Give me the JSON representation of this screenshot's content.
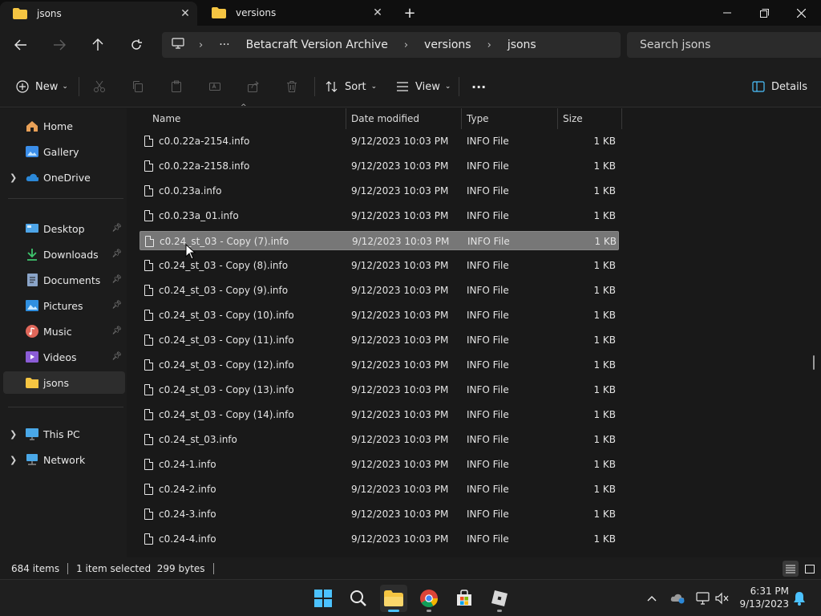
{
  "tabs": [
    {
      "label": "jsons",
      "active": true
    },
    {
      "label": "versions",
      "active": false
    }
  ],
  "new_tab_label": "+",
  "address": {
    "ellipsis": "···",
    "breadcrumbs": [
      "Betacraft Version Archive",
      "versions",
      "jsons"
    ]
  },
  "search": {
    "placeholder": "Search jsons"
  },
  "toolbar": {
    "new_label": "New",
    "sort_label": "Sort",
    "view_label": "View",
    "more_label": "···",
    "details_label": "Details"
  },
  "sidebar": {
    "quick": [
      {
        "label": "Home",
        "icon": "home-icon",
        "expandable": false
      },
      {
        "label": "Gallery",
        "icon": "gallery-icon",
        "expandable": false
      },
      {
        "label": "OneDrive",
        "icon": "cloud-icon",
        "expandable": true
      }
    ],
    "pinned": [
      {
        "label": "Desktop",
        "icon": "desktop-icon",
        "pinned": true
      },
      {
        "label": "Downloads",
        "icon": "download-icon",
        "pinned": true
      },
      {
        "label": "Documents",
        "icon": "document-icon",
        "pinned": true
      },
      {
        "label": "Pictures",
        "icon": "pictures-icon",
        "pinned": true
      },
      {
        "label": "Music",
        "icon": "music-icon",
        "pinned": true
      },
      {
        "label": "Videos",
        "icon": "videos-icon",
        "pinned": true
      },
      {
        "label": "jsons",
        "icon": "folder-icon",
        "pinned": false,
        "selected": true
      }
    ],
    "devices": [
      {
        "label": "This PC",
        "icon": "pc-icon",
        "expandable": true
      },
      {
        "label": "Network",
        "icon": "network-icon",
        "expandable": true
      }
    ]
  },
  "columns": {
    "name": "Name",
    "date": "Date modified",
    "type": "Type",
    "size": "Size"
  },
  "files": [
    {
      "name": "c0.0.22a-2154.info",
      "date": "9/12/2023 10:03 PM",
      "type": "INFO File",
      "size": "1 KB"
    },
    {
      "name": "c0.0.22a-2158.info",
      "date": "9/12/2023 10:03 PM",
      "type": "INFO File",
      "size": "1 KB"
    },
    {
      "name": "c0.0.23a.info",
      "date": "9/12/2023 10:03 PM",
      "type": "INFO File",
      "size": "1 KB"
    },
    {
      "name": "c0.0.23a_01.info",
      "date": "9/12/2023 10:03 PM",
      "type": "INFO File",
      "size": "1 KB"
    },
    {
      "name": "c0.24_st_03 - Copy (7).info",
      "date": "9/12/2023 10:03 PM",
      "type": "INFO File",
      "size": "1 KB",
      "selected": true
    },
    {
      "name": "c0.24_st_03 - Copy (8).info",
      "date": "9/12/2023 10:03 PM",
      "type": "INFO File",
      "size": "1 KB"
    },
    {
      "name": "c0.24_st_03 - Copy (9).info",
      "date": "9/12/2023 10:03 PM",
      "type": "INFO File",
      "size": "1 KB"
    },
    {
      "name": "c0.24_st_03 - Copy (10).info",
      "date": "9/12/2023 10:03 PM",
      "type": "INFO File",
      "size": "1 KB"
    },
    {
      "name": "c0.24_st_03 - Copy (11).info",
      "date": "9/12/2023 10:03 PM",
      "type": "INFO File",
      "size": "1 KB"
    },
    {
      "name": "c0.24_st_03 - Copy (12).info",
      "date": "9/12/2023 10:03 PM",
      "type": "INFO File",
      "size": "1 KB"
    },
    {
      "name": "c0.24_st_03 - Copy (13).info",
      "date": "9/12/2023 10:03 PM",
      "type": "INFO File",
      "size": "1 KB"
    },
    {
      "name": "c0.24_st_03 - Copy (14).info",
      "date": "9/12/2023 10:03 PM",
      "type": "INFO File",
      "size": "1 KB"
    },
    {
      "name": "c0.24_st_03.info",
      "date": "9/12/2023 10:03 PM",
      "type": "INFO File",
      "size": "1 KB"
    },
    {
      "name": "c0.24-1.info",
      "date": "9/12/2023 10:03 PM",
      "type": "INFO File",
      "size": "1 KB"
    },
    {
      "name": "c0.24-2.info",
      "date": "9/12/2023 10:03 PM",
      "type": "INFO File",
      "size": "1 KB"
    },
    {
      "name": "c0.24-3.info",
      "date": "9/12/2023 10:03 PM",
      "type": "INFO File",
      "size": "1 KB"
    },
    {
      "name": "c0.24-4.info",
      "date": "9/12/2023 10:03 PM",
      "type": "INFO File",
      "size": "1 KB"
    }
  ],
  "status": {
    "count": "684 items",
    "selection": "1 item selected  299 bytes"
  },
  "clock": {
    "time": "6:31 PM",
    "date": "9/13/2023"
  },
  "colors": {
    "accent": "#0078d4",
    "folder": "#f5c542",
    "background": "#191919",
    "selected_row": "#777777"
  }
}
